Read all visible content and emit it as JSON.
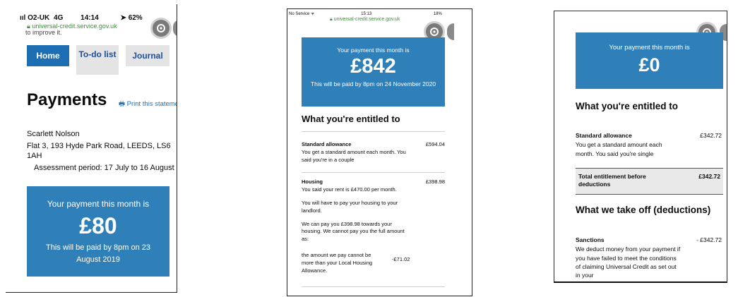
{
  "screens": [
    {
      "status_bar": {
        "carrier": "O2-UK",
        "network": "4G",
        "time": "14:14",
        "battery": "62%"
      },
      "url": "universal-credit.service.gov.uk",
      "cutoff_text": "to improve it.",
      "nav": {
        "home": "Home",
        "todo": "To-do list",
        "journal": "Journal"
      },
      "page_title": "Payments",
      "print_link": "Print this statement",
      "name": "Scarlett Nolson",
      "address": "Flat 3, 193 Hyde Park Road, LEEDS, LS6 1AH",
      "assessment_period": "Assessment period: 17 July to 16 August",
      "payment": {
        "heading": "Your payment this month is",
        "amount": "£80",
        "paid_by": "This will be paid by 8pm on 23 August 2019"
      },
      "colors": {
        "accent": "#2f80b8",
        "nav_active": "#1d70b8"
      }
    },
    {
      "status_bar": {
        "carrier": "No Service",
        "time": "15:13",
        "battery": "18%"
      },
      "url": "universal-credit.service.gov.uk",
      "payment": {
        "heading": "Your payment this month is",
        "amount": "£842",
        "paid_by": "This will be paid by 8pm on 24 November 2020"
      },
      "section_title": "What you're entitled to",
      "standard": {
        "label": "Standard allowance",
        "amount": "£594.04",
        "desc": "You get a standard amount each month. You said you're in a couple"
      },
      "housing": {
        "label": "Housing",
        "amount": "£398.98",
        "desc1": "You said your rent is £470.00 per month.",
        "desc2": "You will have to pay your housing to your landlord.",
        "desc3": "We can pay you £398.98 towards your housing. We cannot pay you the full amount as:",
        "desc4": "the amount we pay cannot be more than your Local Housing Allowance.",
        "deduction": "-£71.02"
      }
    },
    {
      "payment": {
        "heading": "Your payment this month is",
        "amount": "£0"
      },
      "section_title": "What you're entitled to",
      "standard": {
        "label": "Standard allowance",
        "amount": "£342.72",
        "desc": "You get a standard amount each month. You said you're single"
      },
      "total": {
        "label": "Total entitlement before deductions",
        "amount": "£342.72"
      },
      "deductions_title": "What we take off (deductions)",
      "sanctions": {
        "label": "Sanctions",
        "amount": "- £342.72",
        "desc": "We deduct money from your payment if you have failed to meet the conditions of claiming Universal Credit as set out in your"
      }
    }
  ]
}
